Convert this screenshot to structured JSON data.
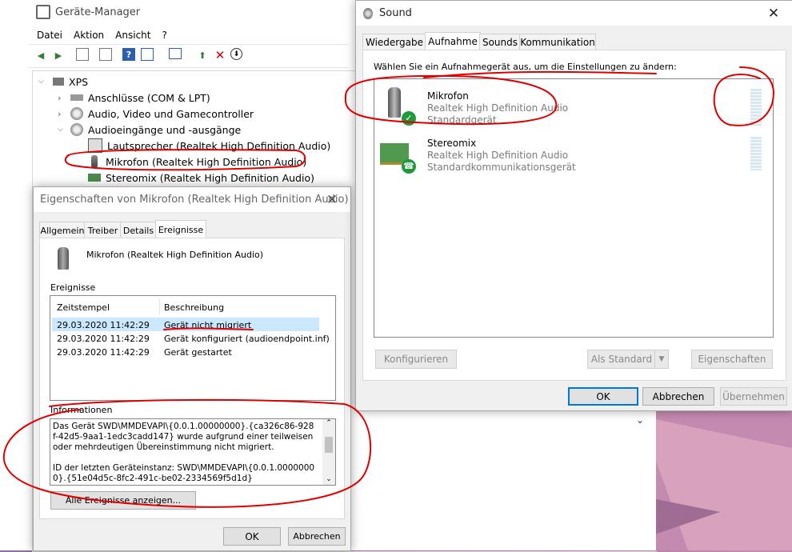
{
  "devmgr": {
    "title": "Geräte-Manager",
    "menu": [
      "Datei",
      "Aktion",
      "Ansicht",
      "?"
    ],
    "tree": {
      "root": "XPS",
      "items": [
        "Anschlüsse (COM & LPT)",
        "Audio, Video und Gamecontroller",
        "Audioeingänge und -ausgänge",
        "Lautsprecher (Realtek High Definition Audio)",
        "Mikrofon (Realtek High Definition Audio)",
        "Stereomix (Realtek High Definition Audio)"
      ]
    }
  },
  "props": {
    "title": "Eigenschaften von Mikrofon (Realtek High Definition Audio)",
    "tabs": [
      "Allgemein",
      "Treiber",
      "Details",
      "Ereignisse"
    ],
    "active_tab": "Ereignisse",
    "device_name": "Mikrofon (Realtek High Definition Audio)",
    "events_label": "Ereignisse",
    "columns": [
      "Zeitstempel",
      "Beschreibung"
    ],
    "events": [
      {
        "time": "29.03.2020 11:42:29",
        "desc": "Gerät nicht migriert"
      },
      {
        "time": "29.03.2020 11:42:29",
        "desc": "Gerät konfiguriert (audioendpoint.inf)"
      },
      {
        "time": "29.03.2020 11:42:29",
        "desc": "Gerät gestartet"
      }
    ],
    "info_label": "Informationen",
    "info_text_1": "Das Gerät SWD\\MMDEVAPI\\{0.0.1.00000000}.{ca326c86-928f-42d5-9aa1-1edc3cadd147} wurde aufgrund einer teilweisen oder mehrdeutigen Übereinstimmung nicht migriert.",
    "info_text_2": "ID der letzten Geräteinstanz: SWD\\MMDEVAPI\\{0.0.1.00000000}.{51e04d5c-8fc2-491c-be02-2334569f5d1d}",
    "all_events_btn": "Alle Ereignisse anzeigen...",
    "ok": "OK",
    "cancel": "Abbrechen"
  },
  "sound": {
    "title": "Sound",
    "tabs": [
      "Wiedergabe",
      "Aufnahme",
      "Sounds",
      "Kommunikation"
    ],
    "active_tab": "Aufnahme",
    "instruction": "Wählen Sie ein Aufnahmegerät aus, um die Einstellungen zu ändern:",
    "devices": [
      {
        "name": "Mikrofon",
        "driver": "Realtek High Definition Audio",
        "status": "Standardgerät"
      },
      {
        "name": "Stereomix",
        "driver": "Realtek High Definition Audio",
        "status": "Standardkommunikationsgerät"
      }
    ],
    "configure": "Konfigurieren",
    "set_default": "Als Standard",
    "properties": "Eigenschaften",
    "ok": "OK",
    "cancel": "Abbrechen",
    "apply": "Übernehmen"
  },
  "colors": {
    "accent": "#0078d7",
    "annotation": "#e00000",
    "selection": "#cce8ff"
  }
}
